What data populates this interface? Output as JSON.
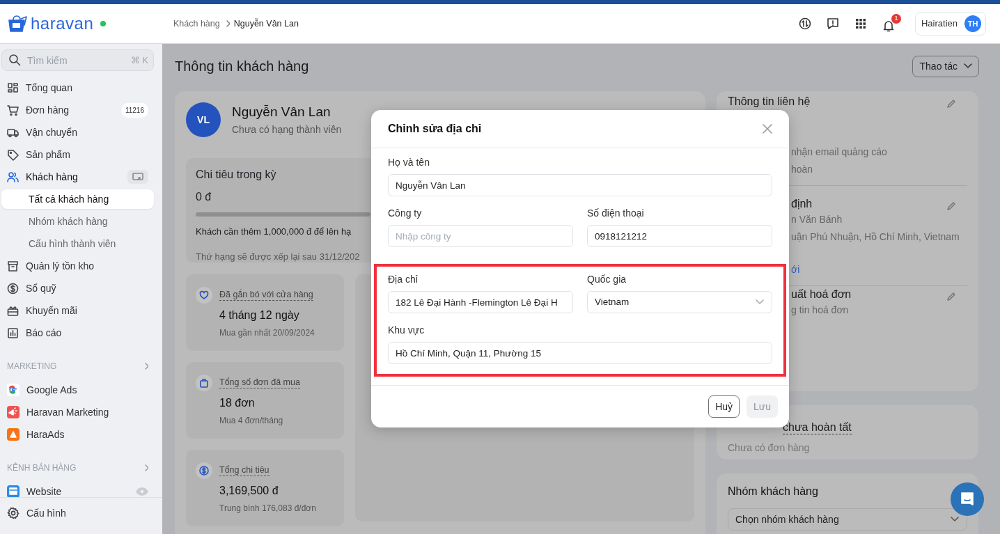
{
  "header": {
    "brand": "haravan",
    "online": true,
    "breadcrumb": [
      "Khách hàng",
      "Nguyễn Vân Lan"
    ],
    "notifications": "1",
    "user": {
      "name": "Hairatien",
      "initials": "TH"
    }
  },
  "sidebar": {
    "search_placeholder": "Tìm kiếm",
    "shortcut": "⌘ K",
    "items": [
      {
        "label": "Tổng quan",
        "selected": false
      },
      {
        "label": "Đơn hàng",
        "badge": "11216",
        "selected": false
      },
      {
        "label": "Vận chuyển",
        "selected": false
      },
      {
        "label": "Sản phẩm",
        "selected": false
      },
      {
        "label": "Khách hàng",
        "selected": false,
        "children": [
          {
            "label": "Tất cả khách hàng",
            "selected": true
          },
          {
            "label": "Nhóm khách hàng",
            "selected": false
          },
          {
            "label": "Cấu hình thành viên",
            "selected": false
          }
        ]
      },
      {
        "label": "Quản lý tồn kho",
        "selected": false
      },
      {
        "label": "Sổ quỹ",
        "selected": false
      },
      {
        "label": "Khuyến mãi",
        "selected": false
      },
      {
        "label": "Báo cáo",
        "selected": false
      }
    ],
    "sections": [
      {
        "title": "MARKETING",
        "items": [
          {
            "label": "Google Ads",
            "selected": false
          },
          {
            "label": "Haravan Marketing",
            "selected": false
          },
          {
            "label": "HaraAds",
            "selected": false
          }
        ]
      },
      {
        "title": "KÊNH BÁN HÀNG",
        "items": [
          {
            "label": "Website",
            "selected": false
          }
        ]
      }
    ],
    "footer_item": "Cấu hình"
  },
  "page": {
    "title": "Thông tin khách hàng",
    "actions_button": "Thao tác"
  },
  "customer": {
    "initials": "VL",
    "name": "Nguyễn Vân Lan",
    "tier": "Chưa có hạng thành viên",
    "spending": {
      "label": "Chi tiêu trong kỳ",
      "value": "0 đ",
      "level": 0,
      "note": "Khách cần thêm 1,000,000 đ để lên hạ",
      "reset": "Thứ hạng sẽ được xếp lại sau 31/12/202"
    },
    "stats": [
      {
        "label": "Đã gắn bó với cửa hàng",
        "value": "4 tháng 12 ngày",
        "note": "Mua gần nhất 20/09/2024"
      },
      {
        "label": "Tổng số đơn đã mua",
        "value": "18 đơn",
        "note": "Mua 4 đơn/tháng"
      },
      {
        "label": "Tổng chi tiêu",
        "value": "3,169,500 đ",
        "note": "Trung bình 176,083 đ/đơn"
      }
    ]
  },
  "info_card": {
    "sections": [
      {
        "title": "Thông tin liên hệ",
        "lines": [
          {
            "kind": "text",
            "text": "nhận email quảng cáo"
          },
          {
            "kind": "text",
            "text": "hoàn"
          }
        ]
      },
      {
        "title": "định",
        "lines": [
          {
            "kind": "text",
            "text": "n Văn Bánh"
          },
          {
            "kind": "text",
            "text": "uận Phú Nhuận, Hồ Chí Minh, Vietnam"
          },
          {
            "kind": "link",
            "text": "ới"
          }
        ]
      },
      {
        "title": "uất hoá đơn",
        "lines": [
          {
            "kind": "text",
            "text": "g tin hoá đơn"
          }
        ]
      }
    ]
  },
  "orders_card": {
    "title": "chưa hoàn tất",
    "empty": "Chưa có đơn hàng"
  },
  "group_card": {
    "title": "Nhóm khách hàng",
    "select_placeholder": "Chọn nhóm khách hàng"
  },
  "modal": {
    "title": "Chỉnh sửa địa chỉ",
    "sections": [
      {
        "highlighted": false,
        "rows": [
          [
            {
              "kind": "text",
              "label": "Họ và tên",
              "value": "Nguyễn Vân Lan"
            }
          ],
          [
            {
              "kind": "text",
              "label": "Công ty",
              "placeholder": "Nhập công ty"
            },
            {
              "kind": "text",
              "label": "Số điện thoại",
              "value": "0918121212"
            }
          ]
        ]
      },
      {
        "highlighted": true,
        "rows": [
          [
            {
              "kind": "text",
              "label": "Địa chỉ",
              "value": "182 Lê Đại Hành -Flemington Lê Đại H"
            },
            {
              "kind": "select",
              "label": "Quốc gia",
              "value": "Vietnam"
            }
          ],
          [
            {
              "kind": "text",
              "label": "Khu vực",
              "value": "Hồ Chí Minh, Quận 11, Phường 15"
            }
          ]
        ]
      }
    ],
    "buttons": [
      {
        "label": "Huỷ",
        "disabled": false
      },
      {
        "label": "Lưu",
        "disabled": true
      }
    ]
  }
}
